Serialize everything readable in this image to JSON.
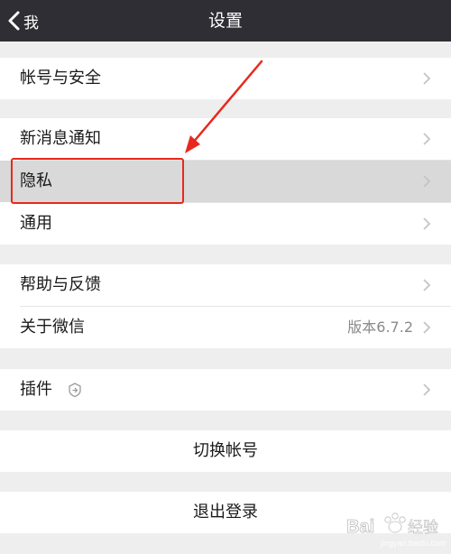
{
  "navbar": {
    "back_label": "我",
    "title": "设置"
  },
  "groups": [
    {
      "items": [
        {
          "label": "帐号与安全"
        }
      ]
    },
    {
      "items": [
        {
          "label": "新消息通知"
        },
        {
          "label": "隐私",
          "highlighted": true
        },
        {
          "label": "通用"
        }
      ]
    },
    {
      "items": [
        {
          "label": "帮助与反馈"
        },
        {
          "label": "关于微信",
          "value": "版本6.7.2"
        }
      ]
    },
    {
      "items": [
        {
          "label": "插件"
        }
      ]
    },
    {
      "items": [
        {
          "label": "切换帐号"
        }
      ]
    },
    {
      "items": [
        {
          "label": "退出登录"
        }
      ]
    }
  ],
  "annotation": {
    "color": "#e8281e"
  },
  "colors": {
    "navbar": "#2e2e34",
    "background": "#eeeeee",
    "highlight": "#d9d9d9"
  },
  "icons": {
    "back": "chevron-left-icon",
    "row": "chevron-right-icon",
    "plugin": "plugin-badge-icon"
  },
  "watermark": {
    "text": "Bai经验",
    "sub": "jingyan.baidu.com"
  }
}
